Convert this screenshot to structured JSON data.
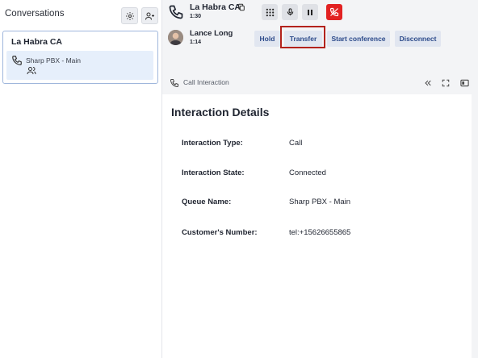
{
  "sidebar": {
    "title": "Conversations",
    "settings_icon": "gear-icon",
    "add_user_icon": "add-user-icon",
    "conversation": {
      "title": "La Habra CA",
      "queue": "Sharp PBX - Main"
    }
  },
  "call": {
    "title": "La Habra CA",
    "time": "1:30",
    "controls": [
      "dialpad-icon",
      "microphone-icon",
      "pause-icon",
      "end-call-icon"
    ]
  },
  "participant": {
    "name": "Lance Long",
    "time": "1:14",
    "actions": {
      "hold": "Hold",
      "transfer": "Transfer",
      "conference": "Start conference",
      "disconnect": "Disconnect"
    }
  },
  "panel": {
    "title": "Call Interaction",
    "heading": "Interaction Details",
    "rows": [
      {
        "label": "Interaction Type:",
        "value": "Call"
      },
      {
        "label": "Interaction State:",
        "value": "Connected"
      },
      {
        "label": "Queue Name:",
        "value": "Sharp PBX - Main"
      },
      {
        "label": "Customer's Number:",
        "value": "tel:+15626655865"
      }
    ]
  },
  "colors": {
    "accent": "#2c4a8a",
    "end_call": "#e22222",
    "highlight_outline": "#b3221c",
    "selected_bg": "#e6effb"
  }
}
